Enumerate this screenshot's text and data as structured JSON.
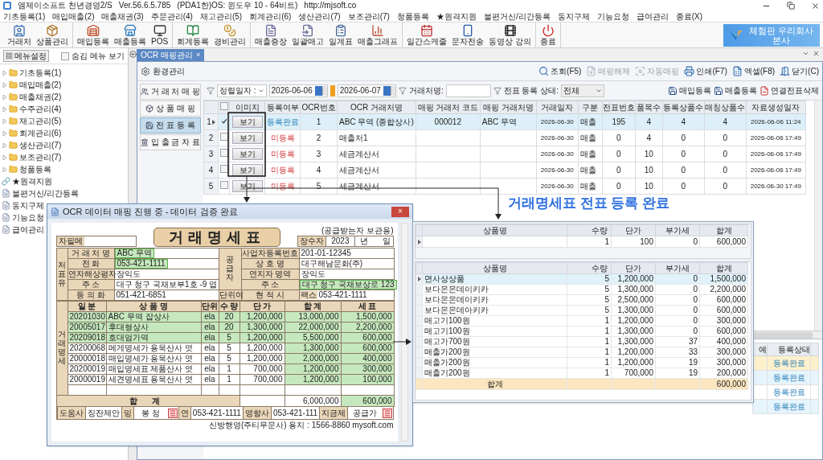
{
  "title_bar": {
    "title": "엠제이소프트 천년경영2/S",
    "version": "Ver.56.6.5.785",
    "system": "(PDA1한)OS: 윈도우 10 - 64비트)",
    "url": "http://mjsoft.co"
  },
  "menu": [
    "기초등록(1)",
    "매입매출(2)",
    "매출채권(3)",
    "주문관리(4)",
    "재고관리(5)",
    "회계관리(6)",
    "생산관리(7)",
    "보조관리(7)",
    "청품등록",
    "★원격지원",
    "불편거신/리간등록",
    "동지구제",
    "기능요청",
    "급여관리",
    "종료(X)"
  ],
  "toolbar_groups": [
    {
      "buttons": [
        "거래처",
        "상품관리"
      ]
    },
    {
      "buttons": [
        "매입등록",
        "매출등록",
        "POS"
      ]
    },
    {
      "buttons": [
        "회계등록",
        "경비관리"
      ]
    },
    {
      "buttons": [
        "매출증장",
        "일괄매고",
        "일계표",
        "매출그래프"
      ]
    },
    {
      "buttons": [
        "일간스케줄",
        "문자전송",
        "동영상 강의"
      ]
    },
    {
      "buttons": [
        "종료"
      ]
    }
  ],
  "company_badge": [
    "체험판 우리회사",
    "본사"
  ],
  "sidebar": {
    "settings_button": "메뉴설정",
    "hidden_toggle": {
      "label": "숨김 메뉴 보기",
      "checked": false
    },
    "items": [
      {
        "label": "기초등록(1)",
        "kind": "folder",
        "expanded": false
      },
      {
        "label": "매입매출(2)",
        "kind": "folder",
        "expanded": false
      },
      {
        "label": "매출채권(2)",
        "kind": "folder",
        "expanded": false
      },
      {
        "label": "수주관리(4)",
        "kind": "folder",
        "expanded": false
      },
      {
        "label": "재고관리(5)",
        "kind": "folder",
        "expanded": false
      },
      {
        "label": "회계관리(6)",
        "kind": "folder",
        "expanded": false
      },
      {
        "label": "생산관리(7)",
        "kind": "folder",
        "expanded": false
      },
      {
        "label": "보조관리(7)",
        "kind": "folder",
        "expanded": false
      },
      {
        "label": "청품등록",
        "kind": "folder",
        "expanded": false
      },
      {
        "label": "★원격지원",
        "kind": "link"
      },
      {
        "label": "불편거신/리간등록",
        "kind": "page"
      },
      {
        "label": "동지구제",
        "kind": "page"
      },
      {
        "label": "기능요청",
        "kind": "page"
      },
      {
        "label": "급여관리",
        "kind": "page"
      }
    ]
  },
  "tabs": [
    {
      "label": "OCR 매핑관리",
      "selected": true,
      "close": "×"
    }
  ],
  "settings_button": "환경관리",
  "actions": [
    {
      "label": "조회(F5)",
      "disabled": false
    },
    {
      "label": "매핑해제",
      "disabled": true
    },
    {
      "label": "자동매핑",
      "disabled": true
    },
    {
      "label": "인쇄(F7)",
      "disabled": false
    },
    {
      "label": "엑셀(F8)",
      "disabled": false
    },
    {
      "label": "닫기(C)",
      "disabled": false
    }
  ],
  "nav": [
    {
      "label": "거 래 처 매 핑",
      "selected": false
    },
    {
      "label": "상 품 매 핑",
      "selected": false
    },
    {
      "label": "전 표 등 록",
      "selected": true
    },
    {
      "label": "입 출 금 자 료",
      "selected": false
    }
  ],
  "filter": {
    "date_type": "정렬일자 :",
    "date_from": "2026-06-06",
    "date_to": "2026-06-07",
    "vendor_label": "거래처명:",
    "status_label": "전표 등록 상태:",
    "status_value": "전체",
    "buttons": [
      "매입등록",
      "매출등록",
      "연결전표삭제"
    ]
  },
  "table": {
    "header_checkbox": {
      "checked": false
    },
    "columns": [
      "이미지",
      "등록여부",
      "OCR번호",
      "OCR 거래처명",
      "매핑 거래처 코드",
      "매핑 거래처명",
      "거래일자",
      "구분",
      "전표번호",
      "품목수",
      "등록상품수",
      "매칭상품수",
      "자료생성일자"
    ],
    "rows": [
      {
        "num": "1",
        "selected": true,
        "checked": true,
        "image_button": "보기",
        "status": "등록완료",
        "registered": true,
        "ocr_no": "1",
        "ocr_vendor": "ABC 무역 (종합상사)",
        "map_code": "000012",
        "map_vendor": "ABC 무역",
        "date": "2026-06-30",
        "type": "매출",
        "slip_no": "195",
        "item_count": "4",
        "registered_count": "4",
        "matched_count": "4",
        "created": "2026-06-06 11:24"
      },
      {
        "num": "2",
        "selected": false,
        "checked": false,
        "image_button": "보기",
        "status": "미등록",
        "registered": false,
        "ocr_no": "2",
        "ocr_vendor": "매출처1",
        "date": "2026-06-30",
        "type": "매출",
        "slip_no": "0",
        "item_count": "4",
        "registered_count": "0",
        "matched_count": "0",
        "created": "2026-06-06 17:49"
      },
      {
        "num": "3",
        "selected": false,
        "checked": false,
        "image_button": "보기",
        "status": "미등록",
        "registered": false,
        "ocr_no": "3",
        "ocr_vendor": "세금계산서",
        "date": "2026-06-30",
        "type": "매출",
        "slip_no": "0",
        "item_count": "10",
        "registered_count": "0",
        "matched_count": "0",
        "created": "2026-06-06 17:49"
      },
      {
        "num": "4",
        "selected": false,
        "checked": false,
        "image_button": "보기",
        "status": "미등록",
        "registered": false,
        "ocr_no": "4",
        "ocr_vendor": "세금계산서",
        "date": "2026-06-30",
        "type": "매출",
        "slip_no": "0",
        "item_count": "10",
        "registered_count": "0",
        "matched_count": "0",
        "created": "2026-06-06 17:49"
      },
      {
        "num": "5",
        "selected": false,
        "checked": false,
        "image_button": "보기",
        "status": "미등록",
        "registered": false,
        "ocr_no": "5",
        "ocr_vendor": "세금계산서",
        "date": "2026-06-30",
        "type": "매출",
        "slip_no": "0",
        "item_count": "10",
        "registered_count": "0",
        "matched_count": "0",
        "created": "2026-06-30 17:49"
      }
    ]
  },
  "lower_panel": {
    "columns": [
      "예",
      "등록상태"
    ],
    "rows": [
      "등록완료",
      "등록완료",
      "등록완료",
      "등록완료"
    ]
  },
  "annotation": "거래명세표 전표 등록 완료",
  "ocr_window": {
    "title": "OCR 데이터 매핑 진행 중 - 데이터 검증 완료",
    "close": "×",
    "document": {
      "title": "거래명세표",
      "copy_note": "(공급받는자 보관용)",
      "memo_label": "자필메",
      "count_label": "장수자",
      "year": "2023",
      "year_label": "년",
      "day_label": "일",
      "buyer_label": "저표유",
      "supplier_label": "공급자",
      "fields": [
        {
          "label": "거 래 처 명",
          "value": "ABC 무역",
          "matched": true,
          "right_label": "사업자등록번호",
          "right_value": "201-01-12345",
          "right_matched": false
        },
        {
          "label": "전 화",
          "value": "053-421-1111",
          "matched": true,
          "right_label": "상 호 명",
          "right_value": "대구해남문화(주)",
          "right_matched": false
        },
        {
          "label": "연자해상평자",
          "value": "장익도",
          "matched": false,
          "right_label": "연지자 명역",
          "right_value": "장익도",
          "right_matched": false
        },
        {
          "label": "주 소",
          "value": "대구 청구 국채보부1호 -9 엽",
          "matched": false,
          "right_label": "주 소",
          "right_value": "대구 청구 국채보상로 123",
          "right_matched": true
        },
        {
          "label": "등 의 화",
          "value": "051-421-6851",
          "matched": false,
          "mid_label": "단위여",
          "right_label": "현 적 시",
          "right_sub": "팩스",
          "right_value": "053-421-1111",
          "right_matched": false
        }
      ],
      "items_label": "거래명세",
      "item_columns": [
        "일 분",
        "상 품 명",
        "단위",
        "수 량",
        "단 가",
        "합 계",
        "세 표"
      ],
      "items": [
        {
          "cells": [
            "20201030",
            "ABC 무역 잡상사",
            "ela",
            "20",
            "1,200,000",
            "13,000,000",
            "1,500,000"
          ],
          "row_matched": true,
          "amount_matched": true
        },
        {
          "cells": [
            "20005017",
            "후대형상사",
            "ela",
            "20",
            "1,300,000",
            "22,000,000",
            "2,200,000"
          ],
          "row_matched": true,
          "amount_matched": true
        },
        {
          "cells": [
            "20209018",
            "호대엄가역",
            "ela",
            "5",
            "1,200,000",
            "5,500,000",
            "600,000"
          ],
          "row_matched": true,
          "amount_matched": true
        },
        {
          "cells": [
            "20200068",
            "메게명세가 용묵산사 엿",
            "ela",
            "5",
            "1,200,000",
            "1,300,000",
            "600,000"
          ],
          "row_matched": false,
          "amount_matched": true
        },
        {
          "cells": [
            "20000018",
            "매입명세가 용묵산사 엿",
            "ela",
            "5",
            "1,200,000",
            "2,000,000",
            "400,000"
          ],
          "row_matched": false,
          "amount_matched": true
        },
        {
          "cells": [
            "20200019",
            "매입명세표 제품산사 엿",
            "ela",
            "1",
            "700,000",
            "1,200,000",
            "300,000"
          ],
          "row_matched": false,
          "amount_matched": true
        },
        {
          "cells": [
            "20000019",
            "세견명세표 용묵산사 엿",
            "ela",
            "1",
            "700,000",
            "1,200,000",
            "100,000"
          ],
          "row_matched": false,
          "amount_matched": true
        }
      ],
      "total_label": "합 계",
      "total_amount": "6,000,000",
      "total_tax": "600,000",
      "total_tax_matched": true,
      "footer": [
        {
          "kind": "label",
          "text": "도움사"
        },
        {
          "kind": "value",
          "text": "징잔제안"
        },
        {
          "kind": "label",
          "text": "밍"
        },
        {
          "kind": "value",
          "text": "봉 정"
        },
        {
          "kind": "stamp"
        },
        {
          "kind": "label",
          "text": "연"
        },
        {
          "kind": "value",
          "text": "053-421-1111"
        },
        {
          "kind": "label",
          "text": "영향사"
        },
        {
          "kind": "value",
          "text": "053-421-111"
        },
        {
          "kind": "label",
          "text": "지금제"
        },
        {
          "kind": "value",
          "text": "공급가"
        },
        {
          "kind": "stamp"
        }
      ],
      "printer_note": "신방행영(주티무문사) 용지 : 1566-8860 mysoft.com"
    }
  },
  "result_window": {
    "top_columns": [
      "상품명",
      "수량",
      "단가",
      "부가세",
      "합계"
    ],
    "columns": [
      "상품명",
      "수량",
      "단가",
      "부가세",
      "합계"
    ],
    "top_rows": [
      {
        "cells": [
          "",
          "1",
          "100",
          "0",
          "600,000"
        ],
        "selected": false
      }
    ],
    "rows": [
      {
        "cells": [
          "면사상상품",
          "5",
          "1,200,000",
          "0",
          "1,500,000"
        ],
        "selected": true
      },
      {
        "cells": [
          "보다몬몬데이키카",
          "5",
          "1,300,000",
          "0",
          "2,200,000"
        ],
        "selected": false
      },
      {
        "cells": [
          "보다몬몬데이키카",
          "5",
          "2,500,000",
          "0",
          "600,000"
        ],
        "selected": false
      },
      {
        "cells": [
          "보다몬몬데아키카",
          "5",
          "1,300,000",
          "0",
          "600,000"
        ],
        "selected": false
      },
      {
        "cells": [
          "매고기100원",
          "1",
          "1,200,000",
          "0",
          "300,000"
        ],
        "selected": false
      },
      {
        "cells": [
          "매고기100원",
          "1",
          "1,300,000",
          "0",
          "600,000"
        ],
        "selected": false
      },
      {
        "cells": [
          "매고가700원",
          "1",
          "1,300,000",
          "37",
          "400,000"
        ],
        "selected": false
      },
      {
        "cells": [
          "매출가200원",
          "1",
          "1,200,000",
          "33",
          "300,000"
        ],
        "selected": false
      },
      {
        "cells": [
          "매출가200원",
          "1",
          "1,200,000",
          "19",
          "300,000"
        ],
        "selected": false
      },
      {
        "cells": [
          "매출기200원",
          "1",
          "700,000",
          "19",
          "200,000"
        ],
        "selected": false
      }
    ],
    "total_label": "합계",
    "total": "600,000"
  }
}
